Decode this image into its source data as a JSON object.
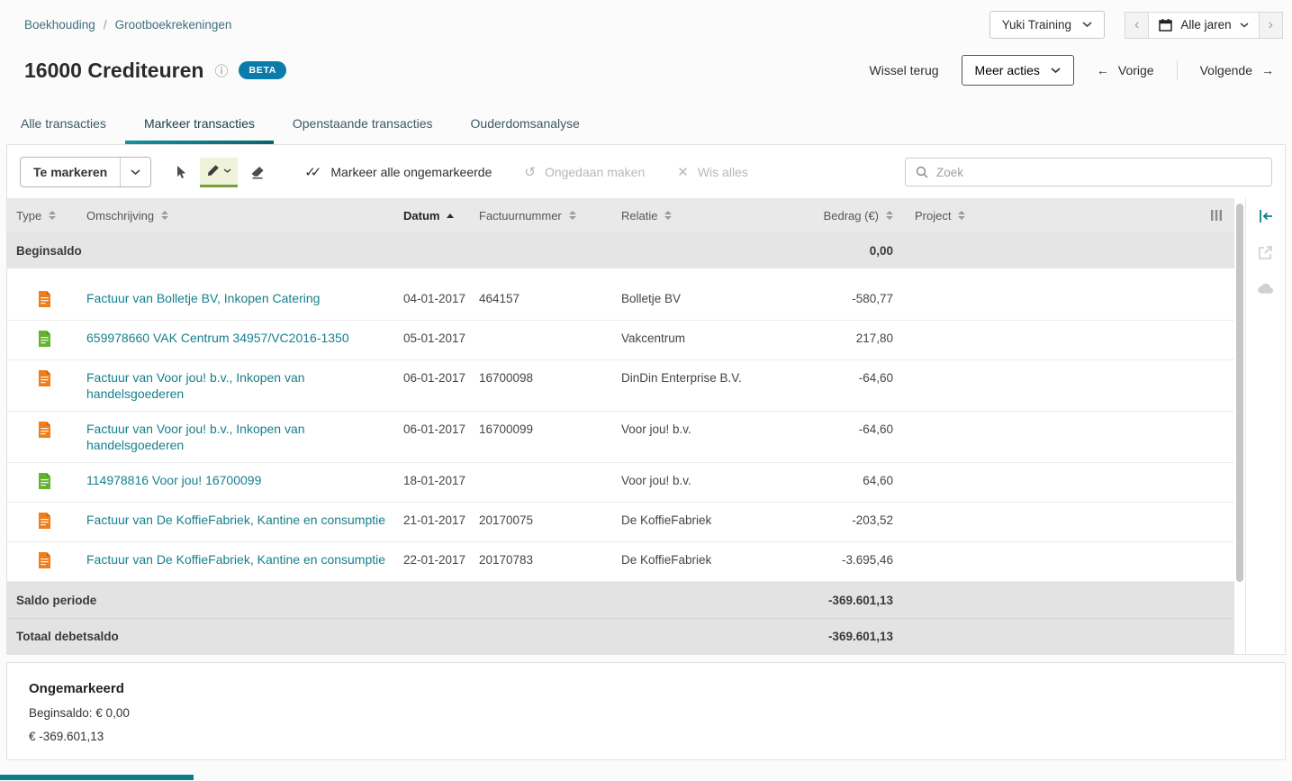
{
  "breadcrumb": {
    "items": [
      {
        "label": "Boekhouding"
      },
      {
        "label": "Grootboekrekeningen"
      }
    ]
  },
  "topbar": {
    "administration_selector": "Yuki Training",
    "year_selector": "Alle jaren"
  },
  "header": {
    "title": "16000 Crediteuren",
    "beta_badge": "BETA",
    "switch_back": "Wissel terug",
    "more_actions": "Meer acties",
    "previous": "Vorige",
    "next": "Volgende"
  },
  "tabs": [
    {
      "label": "Alle transacties"
    },
    {
      "label": "Markeer transacties"
    },
    {
      "label": "Openstaande transacties"
    },
    {
      "label": "Ouderdomsanalyse"
    }
  ],
  "active_tab": "Markeer transacties",
  "toolbar": {
    "mode_button": "Te markeren",
    "mark_all": "Markeer alle ongemarkeerde",
    "undo": "Ongedaan maken",
    "clear_all": "Wis alles",
    "search_placeholder": "Zoek"
  },
  "table": {
    "columns": [
      "Type",
      "Omschrijving",
      "Datum",
      "Factuurnummer",
      "Relatie",
      "Bedrag (€)",
      "Project"
    ],
    "sort": {
      "column": "Datum",
      "direction": "asc"
    },
    "beginsaldo": {
      "label": "Beginsaldo",
      "amount": "0,00"
    },
    "rows": [
      {
        "icon": "invoice-orange",
        "description": "Factuur van Bolletje BV, Inkopen Catering",
        "date": "04-01-2017",
        "invoice": "464157",
        "relation": "Bolletje BV",
        "amount": "-580,77"
      },
      {
        "icon": "statement-green",
        "description": "659978660 VAK Centrum 34957/VC2016-1350",
        "date": "05-01-2017",
        "invoice": "",
        "relation": "Vakcentrum",
        "amount": "217,80"
      },
      {
        "icon": "invoice-orange",
        "description": "Factuur van Voor jou! b.v., Inkopen van handelsgoederen",
        "date": "06-01-2017",
        "invoice": "16700098",
        "relation": "DinDin Enterprise B.V.",
        "amount": "-64,60"
      },
      {
        "icon": "invoice-orange",
        "description": "Factuur van Voor jou! b.v., Inkopen van handelsgoederen",
        "date": "06-01-2017",
        "invoice": "16700099",
        "relation": "Voor jou! b.v.",
        "amount": "-64,60"
      },
      {
        "icon": "statement-green",
        "description": "114978816 Voor jou! 16700099",
        "date": "18-01-2017",
        "invoice": "",
        "relation": "Voor jou! b.v.",
        "amount": "64,60"
      },
      {
        "icon": "invoice-orange",
        "description": "Factuur van De KoffieFabriek, Kantine en consumptie",
        "date": "21-01-2017",
        "invoice": "20170075",
        "relation": "De KoffieFabriek",
        "amount": "-203,52"
      },
      {
        "icon": "invoice-orange",
        "description": "Factuur van De KoffieFabriek, Kantine en consumptie",
        "date": "22-01-2017",
        "invoice": "20170783",
        "relation": "De KoffieFabriek",
        "amount": "-3.695,46"
      }
    ],
    "saldo_periode": {
      "label": "Saldo periode",
      "amount": "-369.601,13"
    },
    "totaal_debetsaldo": {
      "label": "Totaal debetsaldo",
      "amount": "-369.601,13"
    }
  },
  "summary": {
    "title": "Ongemarkeerd",
    "beginsaldo_line": "Beginsaldo: € 0,00",
    "total_line": "€ -369.601,13"
  },
  "icons": {
    "info": "ⓘ",
    "arrow_left": "←",
    "arrow_right": "→",
    "double_check": "✓✓",
    "undo": "↺",
    "close": "✕",
    "chevron_left": "‹",
    "chevron_right": "›"
  },
  "colors": {
    "accent": "#0e7d8a",
    "link": "#16808c",
    "beta_badge": "#0a7cab"
  }
}
